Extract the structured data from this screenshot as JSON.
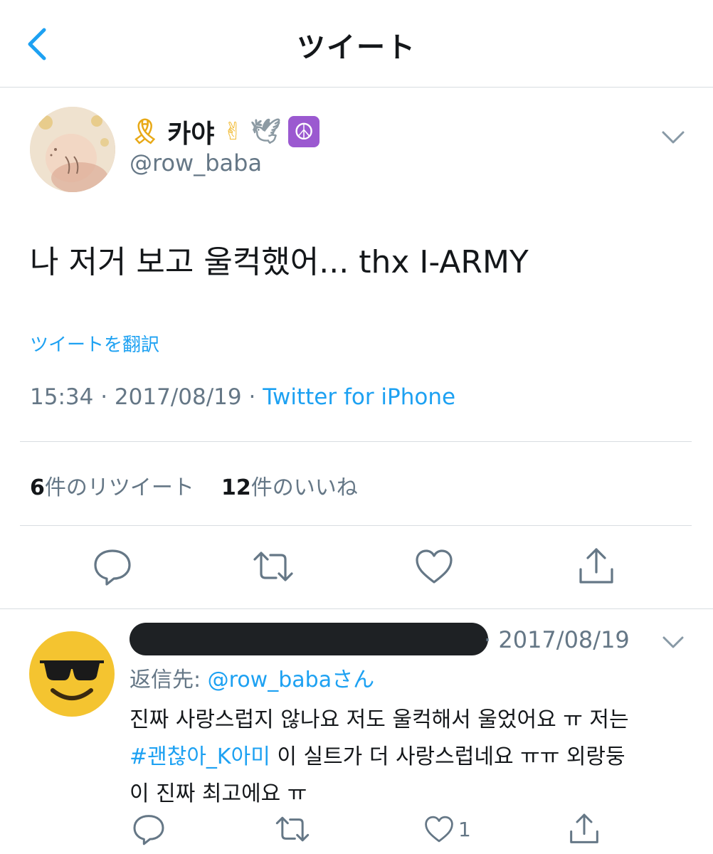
{
  "nav": {
    "title": "ツイート"
  },
  "tweet": {
    "name_emoji_1": "🎗",
    "name": "카야",
    "name_emoji_2": "✌",
    "name_emoji_3": "🕊",
    "name_emoji_4": "☮",
    "handle": "@row_baba",
    "text": "나 저거 보고 울컥했어... thx I-ARMY",
    "translate_label": "ツイートを翻訳",
    "time": "15:34",
    "date": "2017/08/19",
    "separator": "·",
    "source": "Twitter for iPhone",
    "retweet_count": "6",
    "retweet_label": "件のリツイート",
    "like_count": "12",
    "like_label": "件のいいね"
  },
  "reply": {
    "date": "· 2017/08/19",
    "reply_to_label": "返信先: ",
    "reply_to_handle": "@row_babaさん",
    "text_line1": "진짜 사랑스럽지 않나요 저도 울컥해서 울었어요 ㅠ 저는",
    "hashtag": "#괜찮아_K아미",
    "text_line2": " 이 실트가 더 사랑스럽네요 ㅠㅠ 외랑둥",
    "text_line3": "이 진짜 최고에요 ㅠ",
    "like_count": "1"
  },
  "colors": {
    "accent": "#1da1f2",
    "muted": "#657786",
    "text": "#14171a",
    "divider": "#d8dde1",
    "emoji_yellow": "#f4c430"
  },
  "icons": [
    "back-chevron-icon",
    "chevron-down-icon",
    "reply-icon",
    "retweet-icon",
    "heart-icon",
    "share-icon",
    "sunglasses-emoji-avatar"
  ]
}
